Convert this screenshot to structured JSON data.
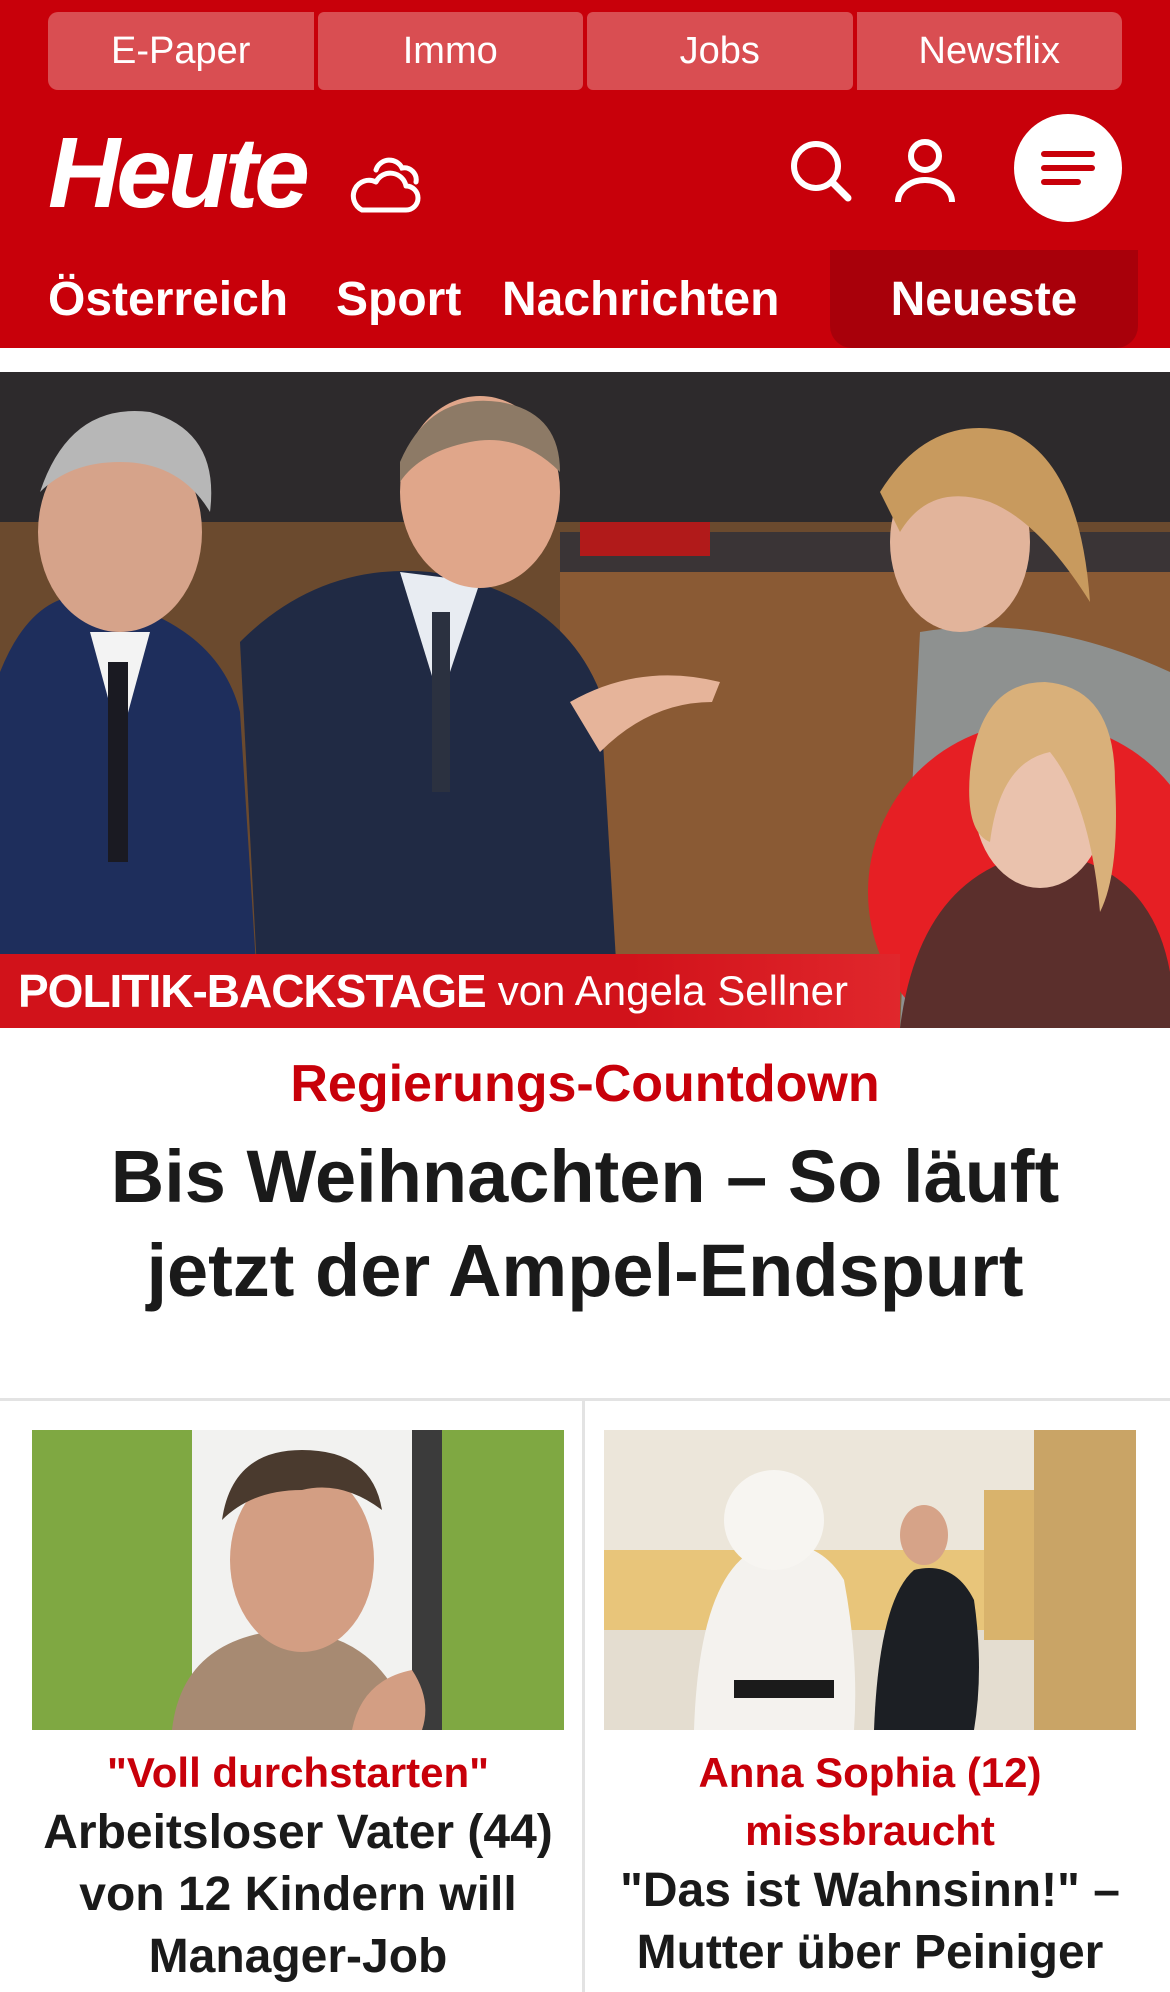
{
  "top_nav": [
    "E-Paper",
    "Immo",
    "Jobs",
    "Newsflix"
  ],
  "brand": {
    "logo": "Heute"
  },
  "icons": {
    "weather": "weather-cloud-icon",
    "search": "search-icon",
    "account": "user-icon",
    "menu": "menu-icon"
  },
  "sections": [
    "Österreich",
    "Sport",
    "Nachrichten",
    "Neueste"
  ],
  "hero": {
    "banner_bold": "POLITIK-BACKSTAGE",
    "banner_rest": "von Angela Sellner",
    "kicker": "Regierungs-Countdown",
    "headline": "Bis Weihnachten – So läuft jetzt der Ampel-Endspurt"
  },
  "cards": [
    {
      "kicker": "\"Voll durchstarten\"",
      "title": "Arbeitsloser Vater (44) von 12 Kindern will Manager-Job"
    },
    {
      "kicker": "Anna Sophia (12) missbraucht",
      "title": "\"Das ist Wahnsinn!\" – Mutter über Peiniger"
    }
  ],
  "colors": {
    "brand_red": "#c8000a",
    "dark_red": "#a8000a",
    "tab_red": "#d94e52"
  }
}
